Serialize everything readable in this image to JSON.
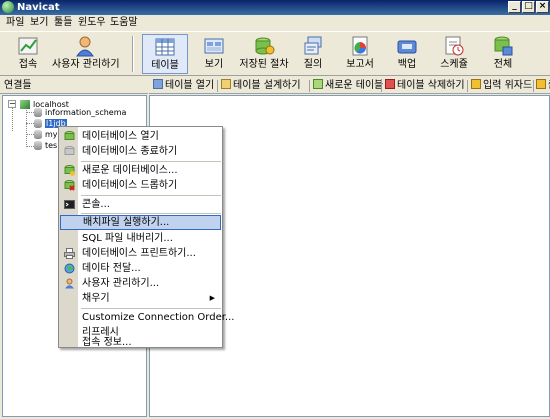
{
  "window": {
    "title": "Navicat"
  },
  "window_buttons": {
    "minimize": "_",
    "maximize": "□",
    "close": "×"
  },
  "menubar": [
    "파일",
    "보기",
    "툴들",
    "윈도우",
    "도움말"
  ],
  "toolbar": {
    "connect": "접속",
    "user_manage": "사용자 관리하기",
    "table": "테이블",
    "view": "보기",
    "stored_proc": "저장된 절차",
    "query": "질의",
    "report": "보고서",
    "backup": "백업",
    "schedule": "스케쥴",
    "all": "전체"
  },
  "leftpane": {
    "header": "연결들"
  },
  "tree": {
    "host": "localhost",
    "items": [
      "information_schema",
      "l1jdb",
      "mys",
      "tes"
    ]
  },
  "objbar": {
    "open_table": "테이블 열기",
    "design_table": "테이블 설계하기",
    "new_table": "새로운 테이블",
    "delete_table": "테이블 삭제하기",
    "import_wizard": "입력 위자드",
    "more": "출"
  },
  "context_menu": {
    "open_db": "데이터베이스 열기",
    "close_db": "데이터베이스 종료하기",
    "new_db": "새로운 데이터베이스...",
    "drop_db": "데이터베이스 드롭하기",
    "console": "콘솔...",
    "run_batch": "배치파일 실행하기...",
    "dump_sql": "SQL 파일 내버리기...",
    "print_db": "데이터베이스 프린트하기...",
    "data_transfer": "데이타 전달...",
    "manage_users": "사용자 관리하기...",
    "fill": "채우기",
    "customize_order": "Customize Connection Order...",
    "refresh": "리프레시",
    "conn_info": "접속 정보..."
  },
  "colors": {
    "selection": "#316ac5",
    "menu_highlight": "#c1d2ee",
    "titlebar": "#0a246a"
  }
}
